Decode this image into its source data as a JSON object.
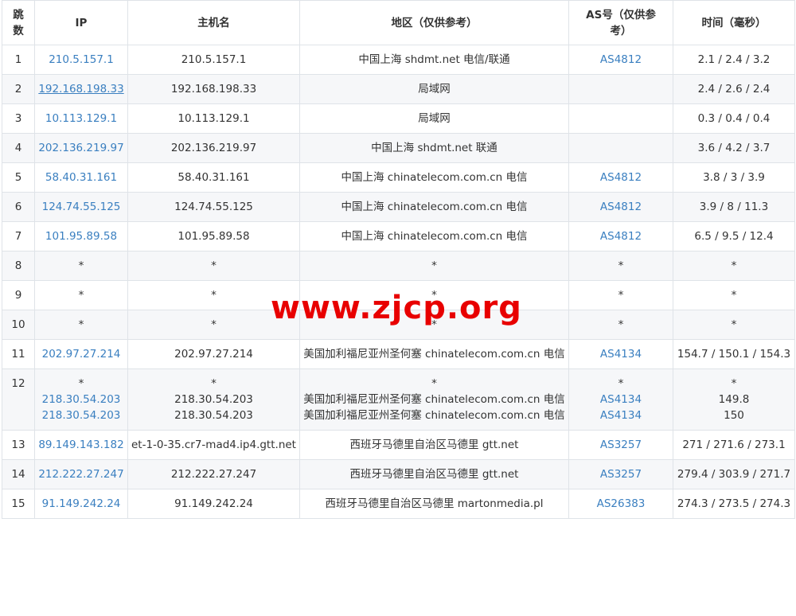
{
  "headers": {
    "hop": "跳数",
    "ip": "IP",
    "host": "主机名",
    "region": "地区（仅供参考）",
    "as": "AS号（仅供参考）",
    "time": "时间（毫秒）"
  },
  "watermark": "www.zjcp.org",
  "rows": [
    {
      "hop": "1",
      "ip": [
        "210.5.157.1"
      ],
      "host": [
        "210.5.157.1"
      ],
      "region": [
        "中国上海 shdmt.net 电信/联通"
      ],
      "as": [
        "AS4812"
      ],
      "time": [
        "2.1 / 2.4 / 3.2"
      ]
    },
    {
      "hop": "2",
      "ip": [
        "192.168.198.33"
      ],
      "host": [
        "192.168.198.33"
      ],
      "region": [
        "局域网"
      ],
      "as": [
        ""
      ],
      "time": [
        "2.4 / 2.6 / 2.4"
      ]
    },
    {
      "hop": "3",
      "ip": [
        "10.113.129.1"
      ],
      "host": [
        "10.113.129.1"
      ],
      "region": [
        "局域网"
      ],
      "as": [
        ""
      ],
      "time": [
        "0.3 / 0.4 / 0.4"
      ]
    },
    {
      "hop": "4",
      "ip": [
        "202.136.219.97"
      ],
      "host": [
        "202.136.219.97"
      ],
      "region": [
        "中国上海 shdmt.net 联通"
      ],
      "as": [
        ""
      ],
      "time": [
        "3.6 / 4.2 / 3.7"
      ]
    },
    {
      "hop": "5",
      "ip": [
        "58.40.31.161"
      ],
      "host": [
        "58.40.31.161"
      ],
      "region": [
        "中国上海 chinatelecom.com.cn 电信"
      ],
      "as": [
        "AS4812"
      ],
      "time": [
        "3.8 / 3 / 3.9"
      ]
    },
    {
      "hop": "6",
      "ip": [
        "124.74.55.125"
      ],
      "host": [
        "124.74.55.125"
      ],
      "region": [
        "中国上海 chinatelecom.com.cn 电信"
      ],
      "as": [
        "AS4812"
      ],
      "time": [
        "3.9 / 8 / 11.3"
      ]
    },
    {
      "hop": "7",
      "ip": [
        "101.95.89.58"
      ],
      "host": [
        "101.95.89.58"
      ],
      "region": [
        "中国上海 chinatelecom.com.cn 电信"
      ],
      "as": [
        "AS4812"
      ],
      "time": [
        "6.5 / 9.5 / 12.4"
      ]
    },
    {
      "hop": "8",
      "ip": [
        "*"
      ],
      "host": [
        "*"
      ],
      "region": [
        "*"
      ],
      "as": [
        "*"
      ],
      "time": [
        "*"
      ]
    },
    {
      "hop": "9",
      "ip": [
        "*"
      ],
      "host": [
        "*"
      ],
      "region": [
        "*"
      ],
      "as": [
        "*"
      ],
      "time": [
        "*"
      ]
    },
    {
      "hop": "10",
      "ip": [
        "*"
      ],
      "host": [
        "*"
      ],
      "region": [
        "*"
      ],
      "as": [
        "*"
      ],
      "time": [
        "*"
      ]
    },
    {
      "hop": "11",
      "ip": [
        "202.97.27.214"
      ],
      "host": [
        "202.97.27.214"
      ],
      "region": [
        "美国加利福尼亚州圣何塞 chinatelecom.com.cn 电信"
      ],
      "as": [
        "AS4134"
      ],
      "time": [
        "154.7 / 150.1 / 154.3"
      ]
    },
    {
      "hop": "12",
      "ip": [
        "*",
        "218.30.54.203",
        "218.30.54.203"
      ],
      "host": [
        "*",
        "218.30.54.203",
        "218.30.54.203"
      ],
      "region": [
        "*",
        "美国加利福尼亚州圣何塞 chinatelecom.com.cn 电信",
        "美国加利福尼亚州圣何塞 chinatelecom.com.cn 电信"
      ],
      "as": [
        "*",
        "AS4134",
        "AS4134"
      ],
      "time": [
        "*",
        "149.8",
        "150"
      ]
    },
    {
      "hop": "13",
      "ip": [
        "89.149.143.182"
      ],
      "host": [
        "et-1-0-35.cr7-mad4.ip4.gtt.net"
      ],
      "region": [
        "西班牙马德里自治区马德里 gtt.net"
      ],
      "as": [
        "AS3257"
      ],
      "time": [
        "271 / 271.6 / 273.1"
      ]
    },
    {
      "hop": "14",
      "ip": [
        "212.222.27.247"
      ],
      "host": [
        "212.222.27.247"
      ],
      "region": [
        "西班牙马德里自治区马德里 gtt.net"
      ],
      "as": [
        "AS3257"
      ],
      "time": [
        "279.4 / 303.9 / 271.7"
      ]
    },
    {
      "hop": "15",
      "ip": [
        "91.149.242.24"
      ],
      "host": [
        "91.149.242.24"
      ],
      "region": [
        "西班牙马德里自治区马德里 martonmedia.pl"
      ],
      "as": [
        "AS26383"
      ],
      "time": [
        "274.3 / 273.5 / 274.3"
      ]
    }
  ],
  "colors": {
    "link": "#3a7fc0",
    "watermark": "#e80000",
    "stripe": "#f6f7f9",
    "border": "#dfe3e8"
  }
}
